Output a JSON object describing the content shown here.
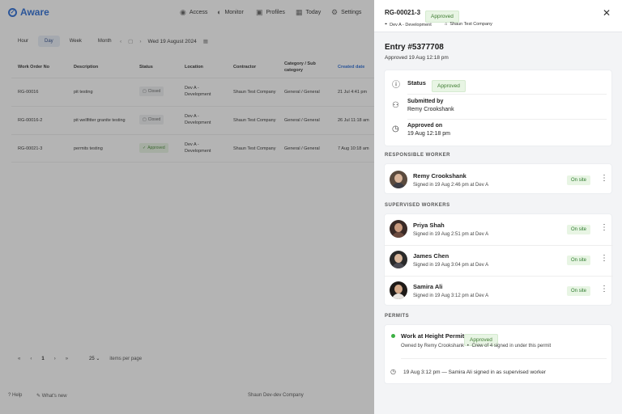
{
  "app": {
    "name": "Aware"
  },
  "nav": [
    {
      "label": "Access",
      "icon": "eye-icon"
    },
    {
      "label": "Monitor",
      "icon": "monitor-icon"
    },
    {
      "label": "Profiles",
      "icon": "profile-icon"
    },
    {
      "label": "Today",
      "icon": "calendar-icon"
    },
    {
      "label": "Settings",
      "icon": "gear-icon"
    }
  ],
  "view_tabs": [
    "Hour",
    "Day",
    "Week",
    "Month"
  ],
  "active_view": "Day",
  "date_label": "Wed 19 August 2024",
  "table": {
    "headers": [
      "Work Order No",
      "Description",
      "Status",
      "Location",
      "Contractor",
      "Category / Sub category",
      "Created date"
    ],
    "rows": [
      {
        "no": "RG-00016",
        "desc": "pit testing",
        "status": "Closed",
        "location": "Dev A - Development",
        "contractor": "Shaun Test Company",
        "category": "General / General",
        "created": "21 Jul 4:41 pm"
      },
      {
        "no": "RG-00016-2",
        "desc": "pit wellfitter granite testing",
        "status": "Closed",
        "location": "Dev A - Development",
        "contractor": "Shaun Test Company",
        "category": "General / General",
        "created": "26 Jul 11:18 am"
      },
      {
        "no": "RG-00021-3",
        "desc": "permits testing",
        "status": "Approved",
        "location": "Dev A - Development",
        "contractor": "Shaun Test Company",
        "category": "General / General",
        "created": "7 Aug 10:18 am"
      }
    ]
  },
  "pager": {
    "page": "1",
    "per_page": "25",
    "per_page_label": "items per page"
  },
  "footer": {
    "help": "Help",
    "whats_new": "What's new",
    "company": "Shaun Dev-dev Company"
  },
  "panel": {
    "id": "RG-00021-3",
    "status_badge": "Approved",
    "location": "Dev A - Development",
    "company": "Shaun Test Company",
    "entry_title": "Entry #5377708",
    "entry_sub": "Approved 19 Aug 12:18 pm",
    "status_label": "Status",
    "status_value": "Approved",
    "submitted_label": "Submitted by",
    "submitted_by": "Remy Crookshank",
    "approved_label": "Approved on",
    "approved_on": "19 Aug 12:18 pm",
    "responsible_title": "RESPONSIBLE WORKER",
    "responsible": {
      "name": "Remy Crookshank",
      "sub": "Signed in 19 Aug 2:46 pm at Dev A",
      "status": "On site"
    },
    "supervised_title": "SUPERVISED WORKERS",
    "supervised": [
      {
        "name": "Priya Shah",
        "sub": "Signed in 19 Aug 2:51 pm at Dev A",
        "status": "On site"
      },
      {
        "name": "James Chen",
        "sub": "Signed in 19 Aug 3:04 pm at Dev A",
        "status": "On site"
      },
      {
        "name": "Samira Ali",
        "sub": "Signed in 19 Aug 3:12 pm at Dev A",
        "status": "On site"
      }
    ],
    "permits_title": "PERMITS",
    "permit": {
      "name": "Work at Height Permit",
      "status": "Approved",
      "owner": "Owned by Remy Crookshank",
      "crew": "Crew of 4 signed in under this permit",
      "sep": "•"
    },
    "event": {
      "time": "19 Aug 3:12 pm",
      "dash": "—",
      "text": "Samira Ali signed in as supervised worker"
    }
  },
  "colors": {
    "brand": "#2f6fd6",
    "approved_bg": "#e8f5e4",
    "approved_text": "#3c7a2f"
  }
}
